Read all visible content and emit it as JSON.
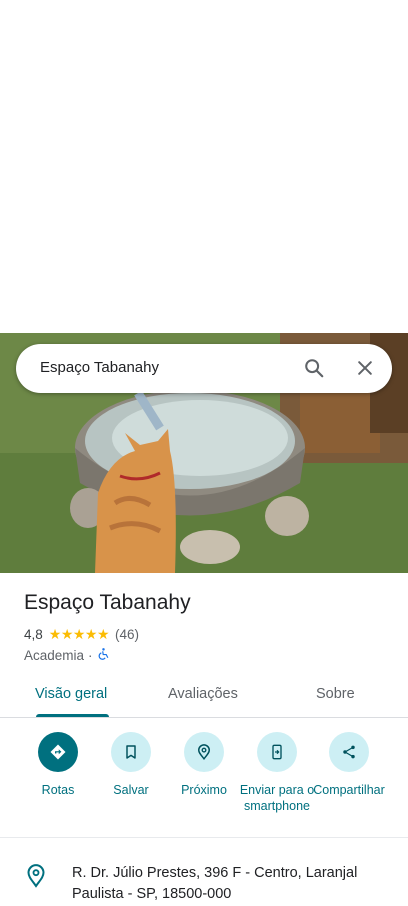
{
  "search": {
    "query": "Espaço Tabanahy"
  },
  "place": {
    "title": "Espaço Tabanahy",
    "rating": "4,8",
    "stars": "★★★★★",
    "reviews_count": "(46)",
    "category": "Academia",
    "separator": "·"
  },
  "tabs": [
    {
      "label": "Visão geral"
    },
    {
      "label": "Avaliações"
    },
    {
      "label": "Sobre"
    }
  ],
  "actions": [
    {
      "label": "Rotas",
      "icon": "directions-icon"
    },
    {
      "label": "Salvar",
      "icon": "bookmark-icon"
    },
    {
      "label": "Próximo",
      "icon": "nearby-icon"
    },
    {
      "label": "Enviar para o smartphone",
      "icon": "send-to-phone-icon"
    },
    {
      "label": "Compartilhar",
      "icon": "share-icon"
    }
  ],
  "address": {
    "text": "R. Dr. Júlio Prestes, 396 F - Centro, Laranjal Paulista - SP, 18500-000"
  },
  "colors": {
    "accent": "#00707f",
    "accent_light": "#cdeff4",
    "star": "#fbbc04"
  }
}
